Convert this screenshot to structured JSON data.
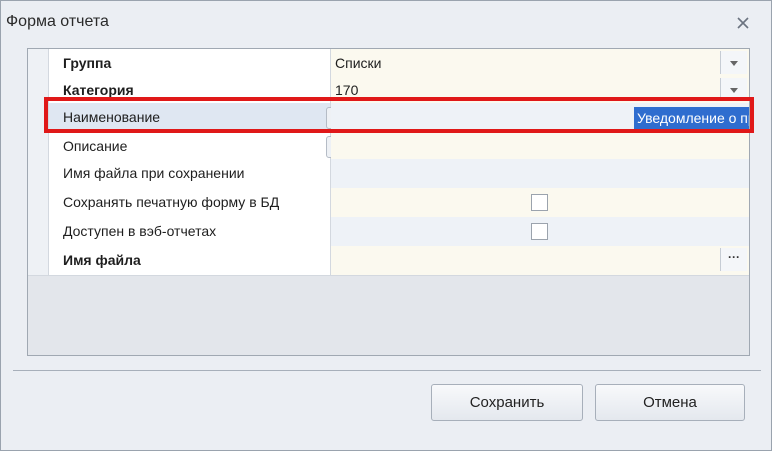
{
  "window": {
    "title": "Форма отчета",
    "close_icon": "close-icon"
  },
  "properties": [
    {
      "label": "Группа",
      "value": "Списки",
      "bold": true,
      "editor": "dropdown"
    },
    {
      "label": "Категория",
      "value": "170",
      "bold": true,
      "editor": "dropdown"
    },
    {
      "label": "Наименование",
      "value": "Уведомление о прибытии иностранного гражданина",
      "bold": false,
      "editor": "text-globe",
      "selected": true
    },
    {
      "label": "Описание",
      "value": "",
      "bold": false,
      "editor": "text-globe"
    },
    {
      "label": "Имя файла при сохранении",
      "value": "",
      "bold": false,
      "editor": "text"
    },
    {
      "label": "Сохранять печатную форму в БД",
      "checked": false,
      "bold": false,
      "editor": "checkbox"
    },
    {
      "label": "Доступен в вэб-отчетах",
      "checked": false,
      "bold": false,
      "editor": "checkbox"
    },
    {
      "label": "Имя файла",
      "value": "",
      "bold": true,
      "editor": "ellipsis"
    }
  ],
  "buttons": {
    "save": "Сохранить",
    "cancel": "Отмена"
  },
  "icons": {
    "dropdown": "chevron-down-icon",
    "globe": "globe-icon",
    "ellipsis": "ellipsis-icon"
  },
  "colors": {
    "highlight": "#e01818",
    "selection": "#2f6dcf"
  }
}
